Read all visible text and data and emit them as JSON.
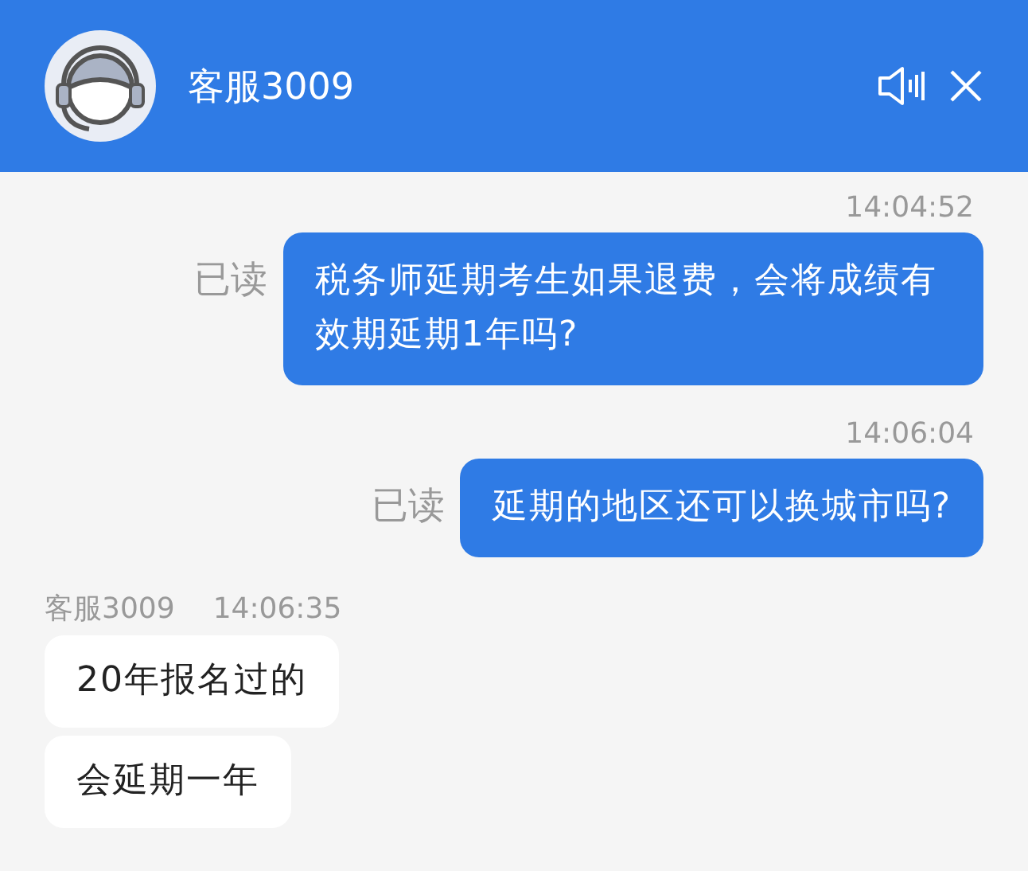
{
  "header": {
    "title": "客服3009"
  },
  "messages": [
    {
      "kind": "outgoing",
      "time": "14:04:52",
      "status": "已读",
      "text": "税务师延期考生如果退费，会将成绩有效期延期1年吗?"
    },
    {
      "kind": "outgoing",
      "time": "14:06:04",
      "status": "已读",
      "text": "延期的地区还可以换城市吗?"
    },
    {
      "kind": "incoming",
      "sender": "客服3009",
      "time": "14:06:35",
      "bubbles": [
        "20年报名过的",
        "会延期一年"
      ]
    }
  ]
}
